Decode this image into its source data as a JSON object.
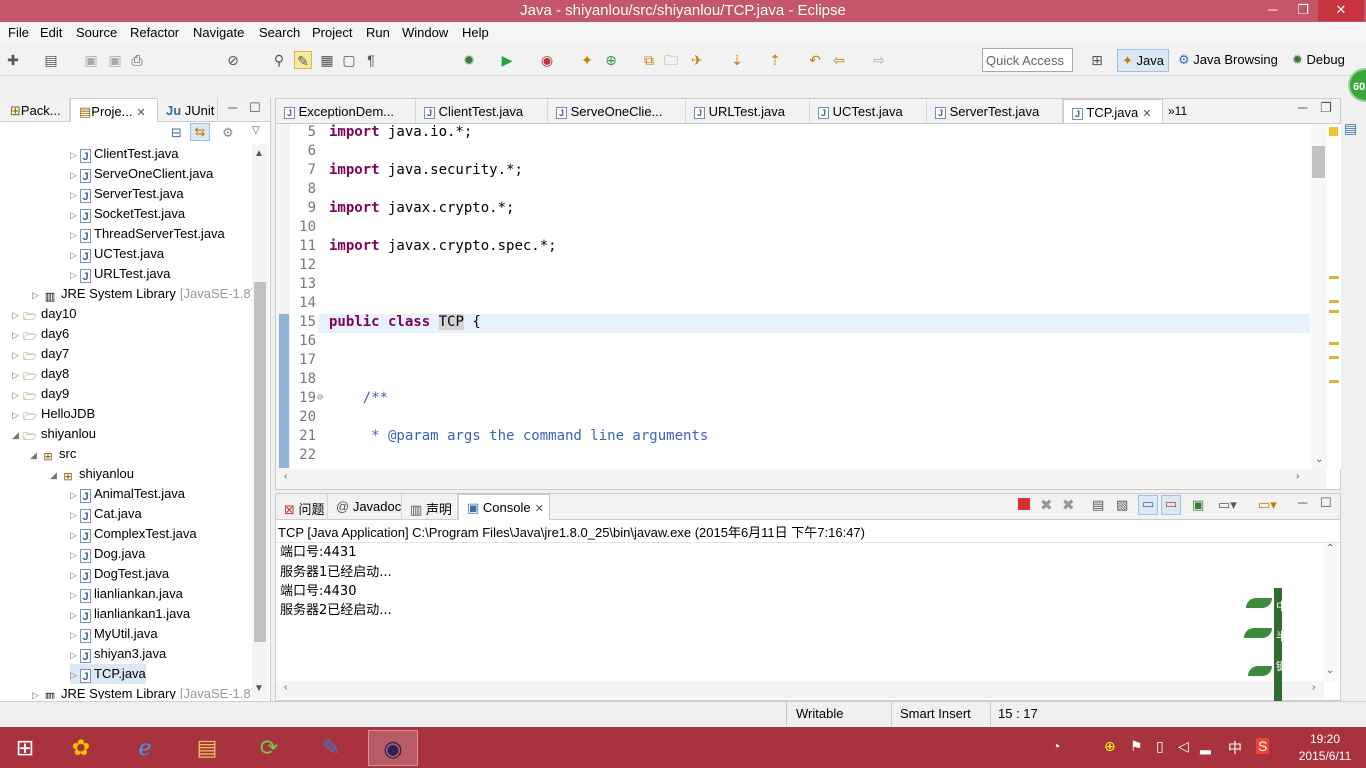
{
  "window": {
    "title": "Java - shiyanlou/src/shiyanlou/TCP.java - Eclipse"
  },
  "menu": [
    "File",
    "Edit",
    "Source",
    "Refactor",
    "Navigate",
    "Search",
    "Project",
    "Run",
    "Window",
    "Help"
  ],
  "toolbar": {
    "quick_access_placeholder": "Quick Access",
    "perspectives": [
      "Java",
      "Java Browsing",
      "Debug"
    ],
    "badge": "60"
  },
  "left_tabs": [
    "Pack...",
    "Proje...",
    "JUnit"
  ],
  "tree": [
    {
      "label": "ClientTest.java",
      "decor": ""
    },
    {
      "label": "ServeOneClient.java",
      "decor": ""
    },
    {
      "label": "ServerTest.java",
      "decor": ""
    },
    {
      "label": "SocketTest.java",
      "decor": ""
    },
    {
      "label": "ThreadServerTest.java",
      "decor": ""
    },
    {
      "label": "UCTest.java",
      "decor": ""
    },
    {
      "label": "URLTest.java",
      "decor": ""
    },
    {
      "label": "JRE System Library",
      "decor": "[JavaSE-1.8]"
    },
    {
      "label": "day10",
      "decor": ""
    },
    {
      "label": "day6",
      "decor": ""
    },
    {
      "label": "day7",
      "decor": ""
    },
    {
      "label": "day8",
      "decor": ""
    },
    {
      "label": "day9",
      "decor": ""
    },
    {
      "label": "HelloJDB",
      "decor": ""
    },
    {
      "label": "shiyanlou",
      "decor": ""
    },
    {
      "label": "src",
      "decor": ""
    },
    {
      "label": "shiyanlou",
      "decor": ""
    },
    {
      "label": "AnimalTest.java",
      "decor": ""
    },
    {
      "label": "Cat.java",
      "decor": ""
    },
    {
      "label": "ComplexTest.java",
      "decor": ""
    },
    {
      "label": "Dog.java",
      "decor": ""
    },
    {
      "label": "DogTest.java",
      "decor": ""
    },
    {
      "label": "lianliankan.java",
      "decor": ""
    },
    {
      "label": "lianliankan1.java",
      "decor": ""
    },
    {
      "label": "MyUtil.java",
      "decor": ""
    },
    {
      "label": "shiyan3.java",
      "decor": ""
    },
    {
      "label": "TCP.java",
      "decor": ""
    },
    {
      "label": "JRE System Library",
      "decor": "[JavaSE-1.8]"
    }
  ],
  "editor_tabs": [
    "ExceptionDem...",
    "ClientTest.java",
    "ServeOneClie...",
    "URLTest.java",
    "UCTest.java",
    "ServerTest.java",
    "TCP.java"
  ],
  "editor_overflow": "»11",
  "code_lines": [
    {
      "n": "5",
      "kw": "import",
      "rest": " java.io.*;"
    },
    {
      "n": "6",
      "kw": "",
      "rest": ""
    },
    {
      "n": "7",
      "kw": "import",
      "rest": " java.security.*;"
    },
    {
      "n": "8",
      "kw": "",
      "rest": ""
    },
    {
      "n": "9",
      "kw": "import",
      "rest": " javax.crypto.*;"
    },
    {
      "n": "10",
      "kw": "",
      "rest": ""
    },
    {
      "n": "11",
      "kw": "import",
      "rest": " javax.crypto.spec.*;"
    },
    {
      "n": "12",
      "kw": "",
      "rest": ""
    },
    {
      "n": "13",
      "kw": "",
      "rest": ""
    },
    {
      "n": "14",
      "kw": "",
      "rest": ""
    },
    {
      "n": "15",
      "kw": "public class",
      "rest": " TCP {"
    },
    {
      "n": "16",
      "kw": "",
      "rest": ""
    },
    {
      "n": "17",
      "kw": "",
      "rest": ""
    },
    {
      "n": "18",
      "kw": "",
      "rest": ""
    },
    {
      "n": "19",
      "kw": "",
      "rest": "    /**"
    },
    {
      "n": "20",
      "kw": "",
      "rest": ""
    },
    {
      "n": "21",
      "kw": "",
      "rest": "     * @param args the command line arguments"
    },
    {
      "n": "22",
      "kw": "",
      "rest": ""
    }
  ],
  "console_tabs": [
    "问题",
    "Javadoc",
    "声明",
    "Console"
  ],
  "console_header": "TCP [Java Application] C:\\Program Files\\Java\\jre1.8.0_25\\bin\\javaw.exe (2015年6月11日 下午7:16:47)",
  "console_lines": [
    "端口号:4431",
    "服务器1已经启动...",
    "端口号:4430",
    "服务器2已经启动..."
  ],
  "status": {
    "writable": "Writable",
    "insert": "Smart Insert",
    "position": "15 : 17"
  },
  "taskbar": {
    "time": "19:20",
    "date": "2015/6/11",
    "ime": "中"
  },
  "decor_text": [
    "中",
    "半",
    "键"
  ]
}
